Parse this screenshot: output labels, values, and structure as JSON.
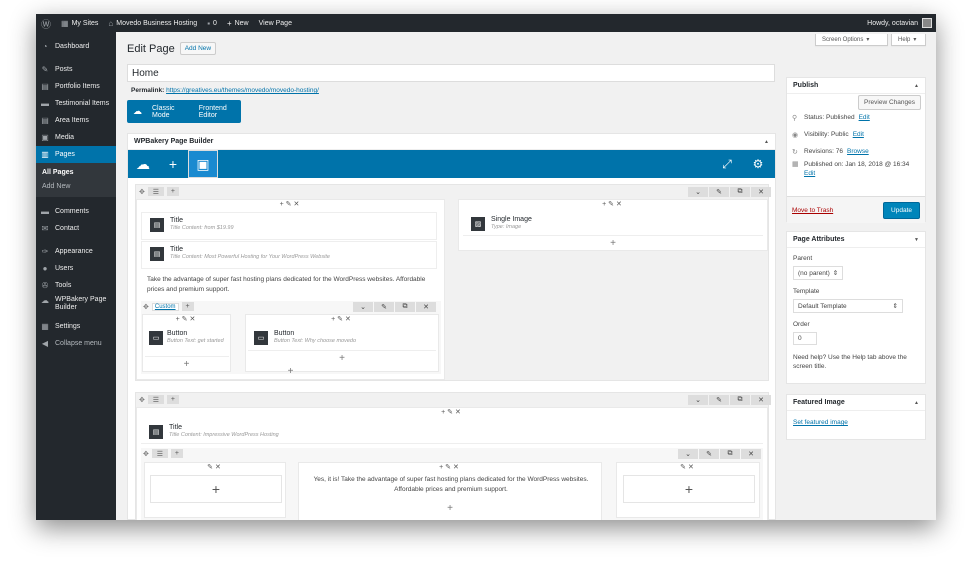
{
  "adminbar": {
    "my_sites": "My Sites",
    "site_name": "Movedo Business Hosting",
    "comments": "0",
    "new": "New",
    "view_page": "View Page",
    "howdy": "Howdy, octavian"
  },
  "menu": {
    "dashboard": "Dashboard",
    "posts": "Posts",
    "portfolio": "Portfolio Items",
    "testimonial": "Testimonial Items",
    "area": "Area Items",
    "media": "Media",
    "pages": "Pages",
    "all_pages": "All Pages",
    "add_new": "Add New",
    "comments": "Comments",
    "contact": "Contact",
    "appearance": "Appearance",
    "users": "Users",
    "tools": "Tools",
    "wpbakery": "WPBakery Page Builder",
    "settings": "Settings",
    "collapse": "Collapse menu"
  },
  "screen_options": "Screen Options",
  "help": "Help",
  "page": {
    "heading": "Edit Page",
    "add_new": "Add New",
    "title_value": "Home",
    "permalink_label": "Permalink:",
    "permalink_url": "https://greatives.eu/themes/movedo/movedo-hosting/",
    "classic_mode": "Classic Mode",
    "frontend_editor": "Frontend Editor"
  },
  "builder": {
    "title": "WPBakery Page Builder",
    "title1": "Title",
    "title1_sub": "Title Content: from $19.99",
    "title2": "Title",
    "title2_sub": "Title Content: Most Powerful Hosting for Your WordPress Website",
    "text1": "Take the advantage of super fast hosting plans dedicated for the WordPress websites. Affordable prices and premium support.",
    "custom": "Custom",
    "button1": "Button",
    "button1_sub": "Button Text: get started",
    "button2": "Button",
    "button2_sub": "Button Text: Why choose movedo",
    "single_image": "Single Image",
    "single_image_sub": "Type: Image",
    "title3": "Title",
    "title3_sub": "Title Content: Impressive WordPress Hosting",
    "text2": "Yes, it is! Take the advantage of super fast hosting plans dedicated for the WordPress websites. Affordable prices and premium support."
  },
  "publish": {
    "title": "Publish",
    "preview": "Preview Changes",
    "status": "Status: Published",
    "visibility": "Visibility: Public",
    "revisions": "Revisions: 76",
    "browse": "Browse",
    "published_on": "Published on: Jan 18, 2018 @ 16:34",
    "edit": "Edit",
    "trash": "Move to Trash",
    "update": "Update"
  },
  "attributes": {
    "title": "Page Attributes",
    "parent_label": "Parent",
    "parent_value": "(no parent)",
    "template_label": "Template",
    "template_value": "Default Template",
    "order_label": "Order",
    "order_value": "0",
    "help": "Need help? Use the Help tab above the screen title."
  },
  "featured": {
    "title": "Featured Image",
    "link": "Set featured image"
  }
}
